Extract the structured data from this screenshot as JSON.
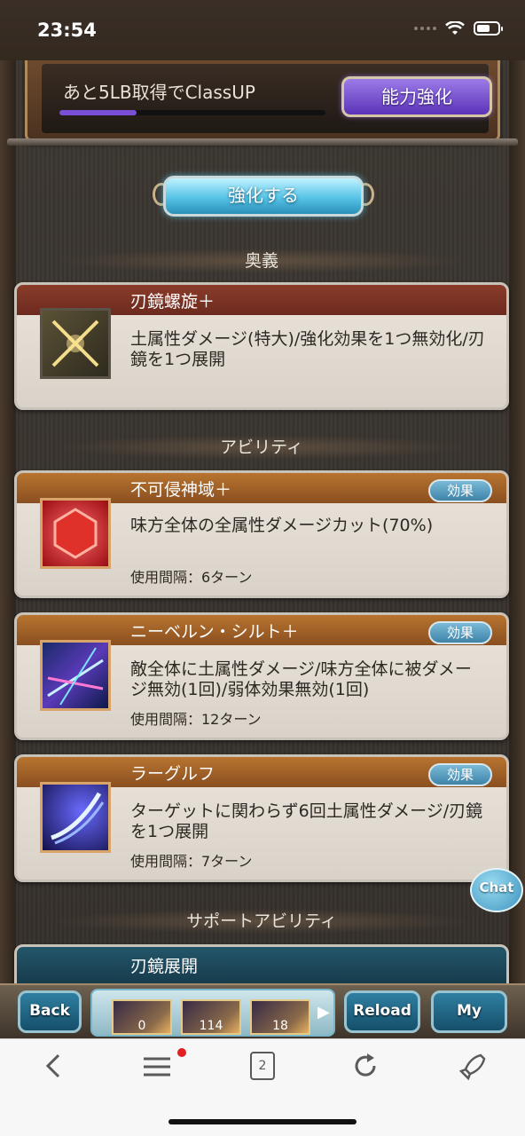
{
  "status_bar": {
    "time": "23:54"
  },
  "class_up": {
    "text": "あと5LB取得でClassUP",
    "progress": 0.29,
    "button_label": "能力強化"
  },
  "strengthen_button": "強化する",
  "sections": {
    "ougi": "奥義",
    "ability": "アビリティ",
    "support": "サポートアビリティ"
  },
  "ougi_card": {
    "title": "刃鏡螺旋＋",
    "description": "土属性ダメージ(特大)/強化効果を1つ無効化/刃鏡を1つ展開"
  },
  "abilities": [
    {
      "title": "不可侵神域＋",
      "effect_label": "効果",
      "description": "味方全体の全属性ダメージカット(70%)",
      "interval": "使用間隔：6ターン"
    },
    {
      "title": "ニーベルン・シルト＋",
      "effect_label": "効果",
      "description": "敵全体に土属性ダメージ/味方全体に被ダメージ無効(1回)/弱体効果無効(1回)",
      "interval": "使用間隔：12ターン"
    },
    {
      "title": "ラーグルフ",
      "effect_label": "効果",
      "description": "ターゲットに関わらず6回土属性ダメージ/刃鏡を1つ展開",
      "interval": "使用間隔：7ターン"
    }
  ],
  "support_card": {
    "title": "刃鏡展開"
  },
  "chat_label": "Chat",
  "game_nav": {
    "back": "Back",
    "reload": "Reload",
    "mypage": "My page",
    "summons": [
      "0",
      "114",
      "18"
    ]
  },
  "browser": {
    "tab_count": "2"
  },
  "colors": {
    "accent_purple": "#7a4fd8",
    "accent_blue": "#57c3e6"
  }
}
